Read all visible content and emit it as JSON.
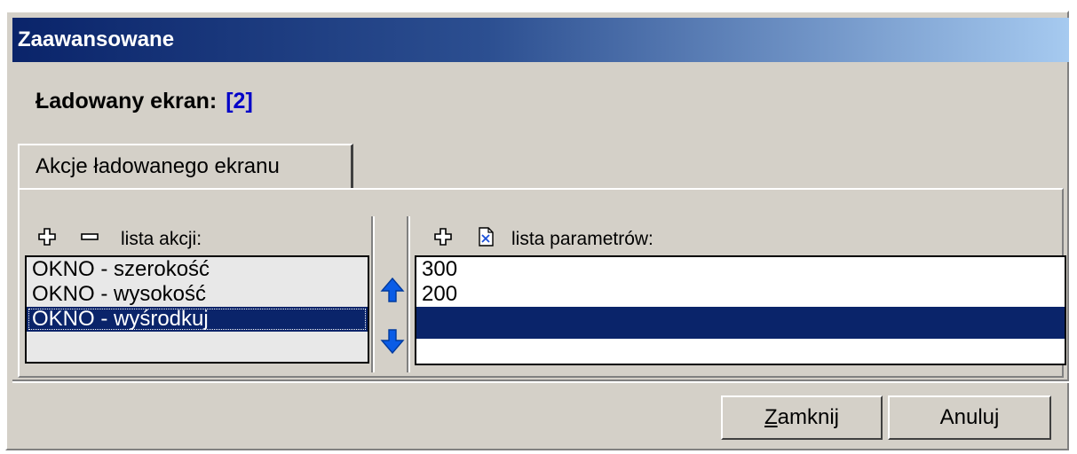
{
  "window": {
    "title": "Zaawansowane"
  },
  "screen": {
    "label": "Ładowany ekran:",
    "value": "[2]"
  },
  "tabs": [
    {
      "label": "Akcje ładowanego ekranu"
    }
  ],
  "actions": {
    "header": "lista akcji:",
    "items": [
      "OKNO - szerokość",
      "OKNO - wysokość",
      "OKNO - wyśrodkuj"
    ],
    "selected": "OKNO - wyśrodkuj"
  },
  "parameters": {
    "header": "lista parametrów:",
    "items": [
      "300",
      "200",
      ""
    ]
  },
  "buttons": {
    "close_label": "Zamknij",
    "cancel_label": "Anuluj"
  },
  "colors": {
    "title_start": "#0a246a",
    "title_end": "#a6caf0",
    "selection": "#0a246a",
    "arrow": "#0a5ce6",
    "screen_value": "#0000c8"
  },
  "icons": [
    "add-icon",
    "remove-icon",
    "add-icon",
    "delete-file-icon",
    "arrow-up-icon",
    "arrow-down-icon"
  ]
}
